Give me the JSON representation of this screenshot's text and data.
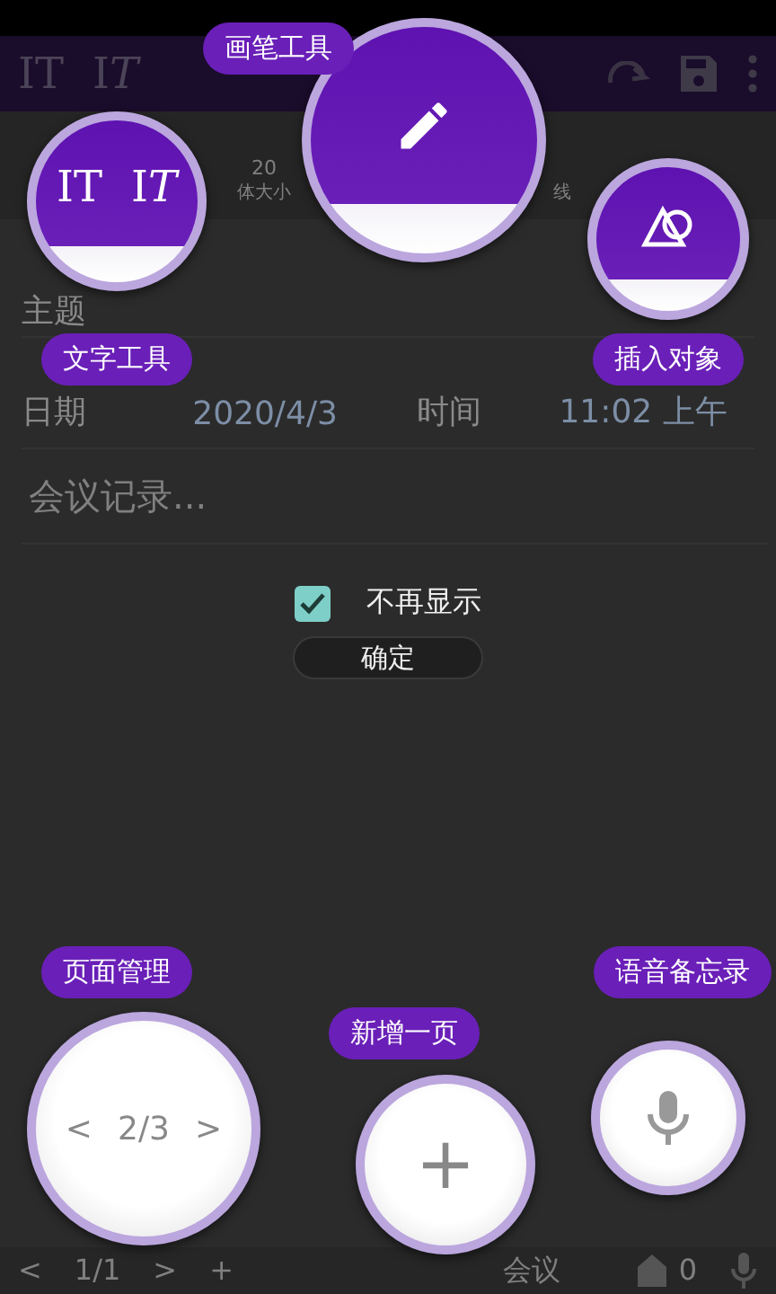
{
  "toolbar": {
    "items": [
      "IT",
      "I𝑇"
    ]
  },
  "format_bar": {
    "size_value": "20",
    "labels": [
      "体大小",
      "线"
    ]
  },
  "form": {
    "subject_label": "主题",
    "date_label": "日期",
    "date_value": "2020/4/3",
    "time_label": "时间",
    "time_value": "11:02 上午",
    "notes": {
      "placeholder": "会议记录..."
    }
  },
  "dialog": {
    "checkbox": {
      "label": "不再显示",
      "checked": true
    },
    "confirm": "确定"
  },
  "bottom_bar": {
    "prev": "<",
    "page": "1/1",
    "next": ">",
    "add": "+",
    "title": "会议",
    "count": "0"
  },
  "guide": [
    {
      "kind": "text_tool",
      "label": "文字工具",
      "icons": [
        "IT",
        "I𝑇"
      ]
    },
    {
      "kind": "pen",
      "label": "画笔工具"
    },
    {
      "kind": "insert",
      "label": "插入对象"
    },
    {
      "kind": "pages",
      "label": "页面管理",
      "prev": "<",
      "page": "2/3",
      "next": ">"
    },
    {
      "kind": "add",
      "label": "新增一页",
      "symbol": "+"
    },
    {
      "kind": "voice",
      "label": "语音备忘录"
    }
  ]
}
